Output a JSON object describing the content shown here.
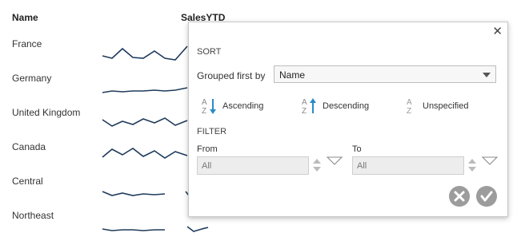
{
  "headers": {
    "name": "Name",
    "sales": "SalesYTD"
  },
  "rows": [
    "France",
    "Germany",
    "United Kingdom",
    "Canada",
    "Central",
    "Northeast"
  ],
  "popup": {
    "sort_title": "SORT",
    "grouped_label": "Grouped first by",
    "grouped_value": "Name",
    "sort_options": [
      "Ascending",
      "Descending",
      "Unspecified"
    ],
    "filter_title": "FILTER",
    "from_label": "From",
    "to_label": "To",
    "from_value": "All",
    "to_value": "All"
  },
  "colors": {
    "sparkline": "#1f3b5c",
    "accent": "#2a8bc9",
    "button_gray": "#9c9c9c"
  },
  "icons": {
    "close": "close-icon",
    "ascending": "sort-ascending-icon",
    "descending": "sort-descending-icon",
    "unspecified": "sort-unspecified-icon",
    "cancel": "cancel-icon",
    "ok": "checkmark-icon"
  }
}
